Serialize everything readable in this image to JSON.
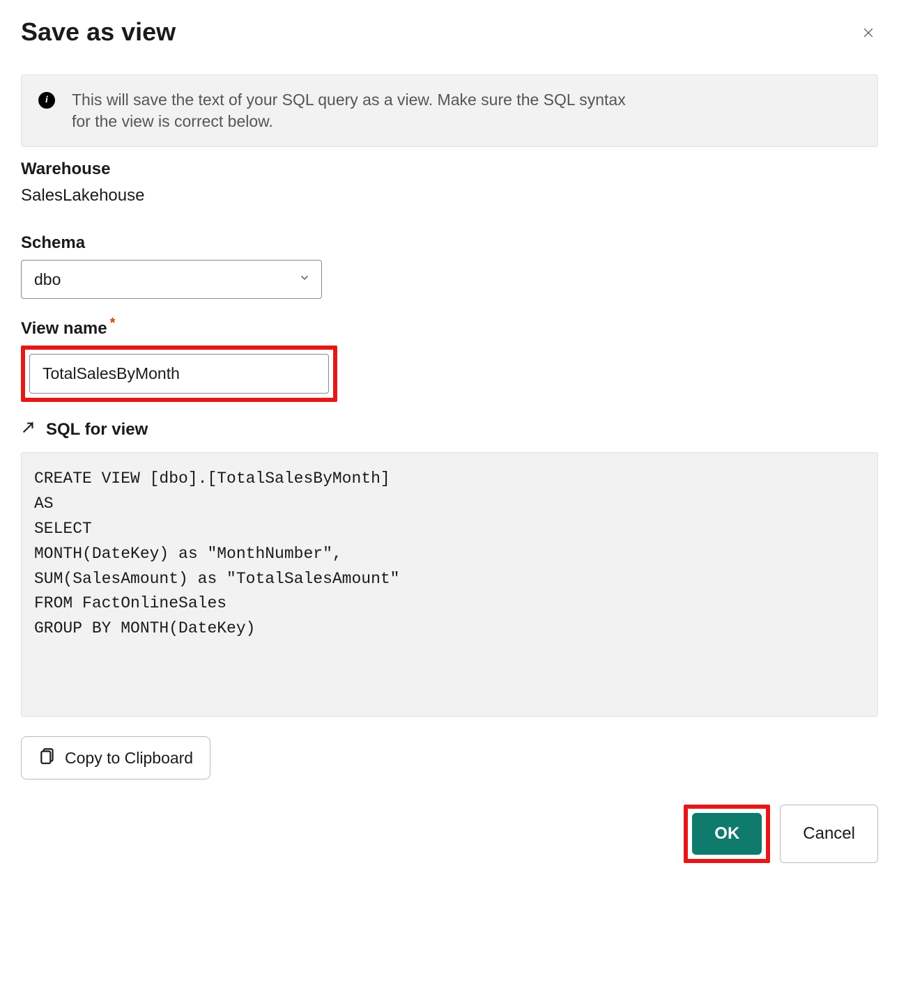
{
  "dialog": {
    "title": "Save as view",
    "info_text": "This will save the text of your SQL query as a view. Make sure the SQL syntax for the view is correct below."
  },
  "warehouse": {
    "label": "Warehouse",
    "value": "SalesLakehouse"
  },
  "schema": {
    "label": "Schema",
    "selected": "dbo"
  },
  "view_name": {
    "label": "View name",
    "value": "TotalSalesByMonth"
  },
  "sql": {
    "header": "SQL for view",
    "content": "CREATE VIEW [dbo].[TotalSalesByMonth]\nAS\nSELECT\nMONTH(DateKey) as \"MonthNumber\",\nSUM(SalesAmount) as \"TotalSalesAmount\"\nFROM FactOnlineSales\nGROUP BY MONTH(DateKey)"
  },
  "buttons": {
    "copy": "Copy to Clipboard",
    "ok": "OK",
    "cancel": "Cancel"
  }
}
